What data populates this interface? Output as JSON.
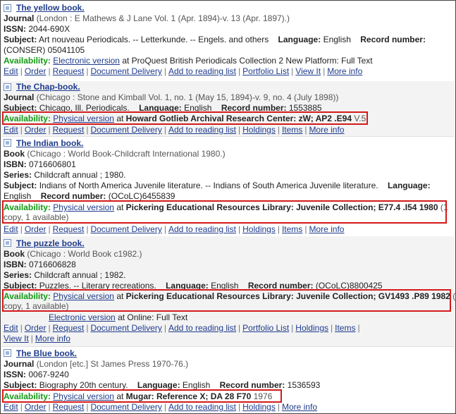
{
  "records": [
    {
      "title": "The yellow book.",
      "type": "Journal",
      "pub": "(London : E Mathews & J Lane Vol. 1 (Apr. 1894)-v. 13 (Apr. 1897).)",
      "issn_label": "ISSN:",
      "issn": "2044-690X",
      "subject_label": "Subject:",
      "subject": "Art nouveau Periodicals. -- Letterkunde. -- Engels. and others",
      "language_label": "Language:",
      "language": "English",
      "record_label": "Record number:",
      "record_wrap": "(CONSER) 05041105",
      "avail_label": "Availability:",
      "avail_link": "Electronic version",
      "avail_rest": "at ProQuest British Periodicals Collection 2 New Platform: Full Text",
      "actions": [
        "Edit",
        "Order",
        "Request",
        "Document Delivery",
        "Add to reading list",
        "Portfolio List",
        "View It",
        "More info"
      ]
    },
    {
      "title": "The Chap-book.",
      "type": "Journal",
      "pub": "(Chicago : Stone and Kimball Vol. 1, no. 1 (May 15, 1894)-v. 9, no. 4 (July 1898))",
      "subject_label": "Subject:",
      "subject": "Chicago, Ill. Periodicals.",
      "language_label": "Language:",
      "language": "English",
      "record_label": "Record number:",
      "record": "1553885",
      "avail_label": "Availability:",
      "avail_link": "Physical version",
      "avail_at": "at",
      "avail_loc": "Howard Gotlieb Archival Research Center: zW; AP2 .E94",
      "avail_rest": "V.5",
      "actions": [
        "Edit",
        "Order",
        "Request",
        "Document Delivery",
        "Add to reading list",
        "Holdings",
        "Items",
        "More info"
      ]
    },
    {
      "title": "The Indian book.",
      "type": "Book",
      "pub": "(Chicago : World Book-Childcraft International 1980.)",
      "isbn_label": "ISBN:",
      "isbn": "0716606801",
      "series_label": "Series:",
      "series": "Childcraft annual ; 1980.",
      "subject_label": "Subject:",
      "subject": "Indians of North America Juvenile literature. -- Indians of South America Juvenile literature.",
      "language_label": "Language:",
      "language": "English",
      "record_label": "Record number:",
      "record": "(OCoLC)6455839",
      "avail_label": "Availability:",
      "avail_link": "Physical version",
      "avail_at": "at",
      "avail_loc": "Pickering Educational Resources Library: Juvenile Collection; E77.4 .I54 1980",
      "avail_rest": "(1",
      "avail_wrap": "copy, 1 available)",
      "actions": [
        "Edit",
        "Order",
        "Request",
        "Document Delivery",
        "Add to reading list",
        "Holdings",
        "Items",
        "More info"
      ]
    },
    {
      "title": "The puzzle book.",
      "type": "Book",
      "pub": "(Chicago : World Book c1982.)",
      "isbn_label": "ISBN:",
      "isbn": "0716606828",
      "series_label": "Series:",
      "series": "Childcraft annual ; 1982.",
      "subject_label": "Subject:",
      "subject": "Puzzles. -- Literary recreations.",
      "language_label": "Language:",
      "language": "English",
      "record_label": "Record number:",
      "record": "(OCoLC)8800425",
      "avail_label": "Availability:",
      "avail_link": "Physical version",
      "avail_at": "at",
      "avail_loc": "Pickering Educational Resources Library: Juvenile Collection; GV1493 .P89 1982",
      "avail_rest": "(1",
      "avail_wrap": "copy, 1 available)",
      "avail2_link": "Electronic version",
      "avail2_rest": "at Online: Full Text",
      "actions": [
        "Edit",
        "Order",
        "Request",
        "Document Delivery",
        "Add to reading list",
        "Portfolio List",
        "Holdings",
        "Items"
      ],
      "actions_wrap": [
        "View It",
        "More info"
      ]
    },
    {
      "title": "The Blue book.",
      "type": "Journal",
      "pub": "(London [etc.] St James Press 1970-76.)",
      "issn_label": "ISSN:",
      "issn": "0067-9240",
      "subject_label": "Subject:",
      "subject": "Biography 20th century.",
      "language_label": "Language:",
      "language": "English",
      "record_label": "Record number:",
      "record": "1536593",
      "avail_label": "Availability:",
      "avail_link": "Physical version",
      "avail_at": "at",
      "avail_loc": "Mugar: Reference X; DA 28 F70",
      "avail_rest": "1976",
      "actions": [
        "Edit",
        "Order",
        "Request",
        "Document Delivery",
        "Add to reading list",
        "Holdings",
        "More info"
      ]
    }
  ],
  "colors": {
    "link": "#1f3c8c",
    "availability": "#139a13",
    "highlight_box": "#d41a1a"
  },
  "icons": {
    "record_checkbox": "checkbox-icon"
  }
}
